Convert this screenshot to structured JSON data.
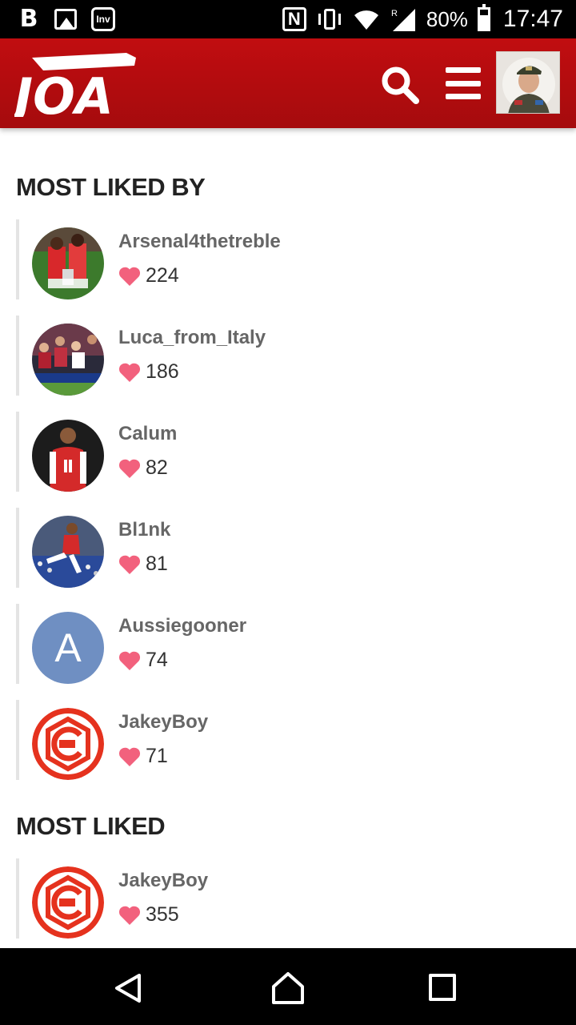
{
  "status_bar": {
    "left_icons": [
      "b-app-icon",
      "image-icon",
      "inv-app-icon"
    ],
    "b_label": "B",
    "inv_label": "Inv",
    "nfc_label": "N",
    "signal_label": "R",
    "battery": "80%",
    "time": "17:47"
  },
  "header": {
    "logo_text": "JOA",
    "icons": [
      "search-icon",
      "menu-icon",
      "user-avatar"
    ]
  },
  "sections": [
    {
      "title": "MOST LIKED BY",
      "users": [
        {
          "name": "Arsenal4thetreble",
          "likes": "224",
          "avatar": "photo-celebration"
        },
        {
          "name": "Luca_from_Italy",
          "likes": "186",
          "avatar": "photo-crowd"
        },
        {
          "name": "Calum",
          "likes": "82",
          "avatar": "photo-player-11"
        },
        {
          "name": "Bl1nk",
          "likes": "81",
          "avatar": "photo-player-kick"
        },
        {
          "name": "Aussiegooner",
          "likes": "74",
          "avatar": "letter",
          "avatar_letter": "A",
          "avatar_color": "#6f8fc2"
        },
        {
          "name": "JakeyBoy",
          "likes": "71",
          "avatar": "arsenal-crest"
        }
      ]
    },
    {
      "title": "MOST LIKED",
      "users": [
        {
          "name": "JakeyBoy",
          "likes": "355",
          "avatar": "arsenal-crest"
        }
      ]
    }
  ],
  "colors": {
    "header_red": "#b10c0f",
    "heart_pink": "#f2617d",
    "username_gray": "#666666"
  },
  "nav_bar": {
    "icons": [
      "back-icon",
      "home-icon",
      "recents-icon"
    ]
  }
}
